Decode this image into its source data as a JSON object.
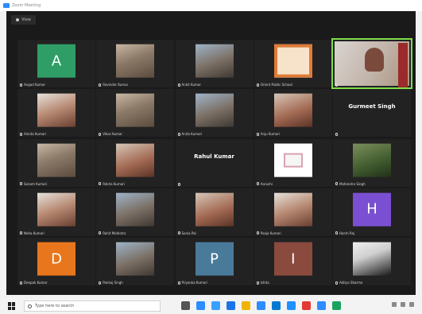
{
  "window": {
    "title": "Zoom Meeting"
  },
  "view_button": {
    "label": "View"
  },
  "participants": [
    {
      "label": "Angad Kumar",
      "letter": "A",
      "color": "#2e9e66"
    },
    {
      "label": "Ravinder Kumar",
      "photo": "photo"
    },
    {
      "label": "Ankit Kumar",
      "photo": "photo2"
    },
    {
      "label": "Orient Public School",
      "photo": "logo"
    },
    {
      "label": "",
      "video": true,
      "active": true
    },
    {
      "label": "Ankita Kumari",
      "photo": "photo3"
    },
    {
      "label": "Vikas Kumar",
      "photo": "photo"
    },
    {
      "label": "Anita Kumari",
      "photo": "photo2"
    },
    {
      "label": "Anju Kumari",
      "photo": "photo5"
    },
    {
      "label": "",
      "bigname": "Gurmeet Singh"
    },
    {
      "label": "Sonam Kumari",
      "photo": "photo"
    },
    {
      "label": "Rekha Kumari",
      "photo": "photo5"
    },
    {
      "label": "",
      "bigname": "Rahul Kumar"
    },
    {
      "label": "Aarushi",
      "photo": "logo2"
    },
    {
      "label": "Mahendra Singh",
      "photo": "photo4"
    },
    {
      "label": "Neha Kumari",
      "photo": "photo3"
    },
    {
      "label": "Rohit Malhotra",
      "photo": "photo2"
    },
    {
      "label": "Sonia Pal",
      "photo": "photo5"
    },
    {
      "label": "Pooja Kumari",
      "photo": "photo3"
    },
    {
      "label": "Harsh Raj",
      "letter": "H",
      "color": "#7a4fd1"
    },
    {
      "label": "Deepak Kumar",
      "letter": "D",
      "color": "#e8761c"
    },
    {
      "label": "Pankaj Singh",
      "photo": "photo2"
    },
    {
      "label": "Priyanka Kumari",
      "letter": "P",
      "color": "#4a7a9a"
    },
    {
      "label": "Ishita",
      "letter": "I",
      "color": "#8a4a3e"
    },
    {
      "label": "Aditya Sharma",
      "photo": "photo6"
    }
  ],
  "taskbar": {
    "search_placeholder": "Type here to search",
    "app_icons": [
      "#555555",
      "#2d8cff",
      "#3aa0ff",
      "#1a73e8",
      "#f0b400",
      "#2d8cff",
      "#0078d4",
      "#1e90ff",
      "#e53935",
      "#2d8cff",
      "#1aa260"
    ]
  }
}
